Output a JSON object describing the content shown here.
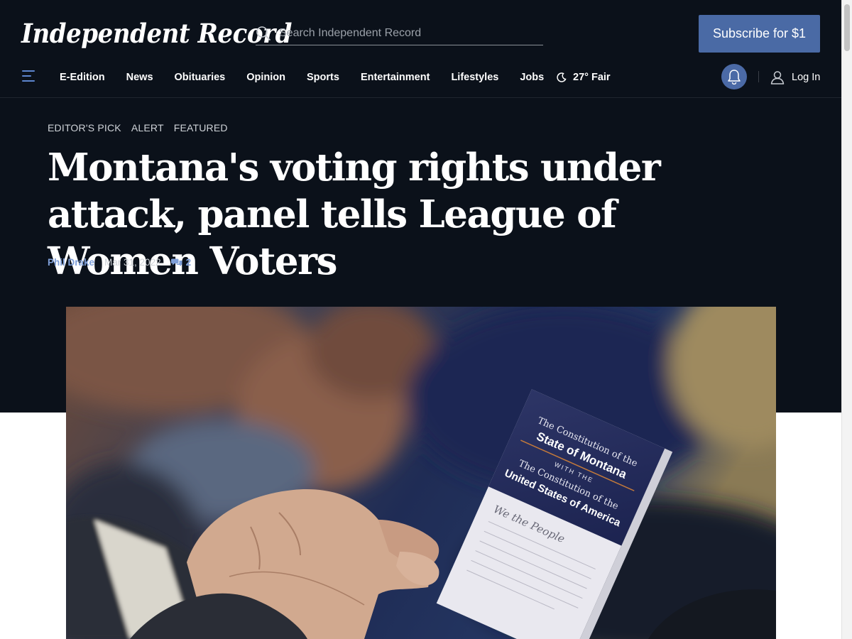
{
  "site": {
    "logo_text": "Independent Record",
    "search_placeholder": "Search Independent Record",
    "subscribe_label": "Subscribe for $1"
  },
  "nav": {
    "items": [
      {
        "label": "E-Edition"
      },
      {
        "label": "News"
      },
      {
        "label": "Obituaries"
      },
      {
        "label": "Opinion"
      },
      {
        "label": "Sports"
      },
      {
        "label": "Entertainment"
      },
      {
        "label": "Lifestyles"
      },
      {
        "label": "Jobs"
      }
    ],
    "weather": "27° Fair",
    "login_label": "Log In"
  },
  "article": {
    "tags": [
      "EDITOR'S PICK",
      "ALERT",
      "FEATURED"
    ],
    "headline": "Montana's voting rights under attack, panel tells League of Women Voters",
    "author": "Phil Drake",
    "date": "Mar 31, 2022",
    "comment_count": "2",
    "photo": {
      "book_lines": [
        "The Constitution of the",
        "State of Montana",
        "WITH THE",
        "The Constitution of the",
        "United States of America"
      ],
      "book_script": "We the People"
    }
  },
  "colors": {
    "header_bg": "#0b111a",
    "accent": "#4a6aa5",
    "link": "#7f9fd8"
  },
  "icons": [
    "search-icon",
    "menu-icon",
    "moon-icon",
    "bell-icon",
    "user-icon",
    "comment-icon"
  ]
}
